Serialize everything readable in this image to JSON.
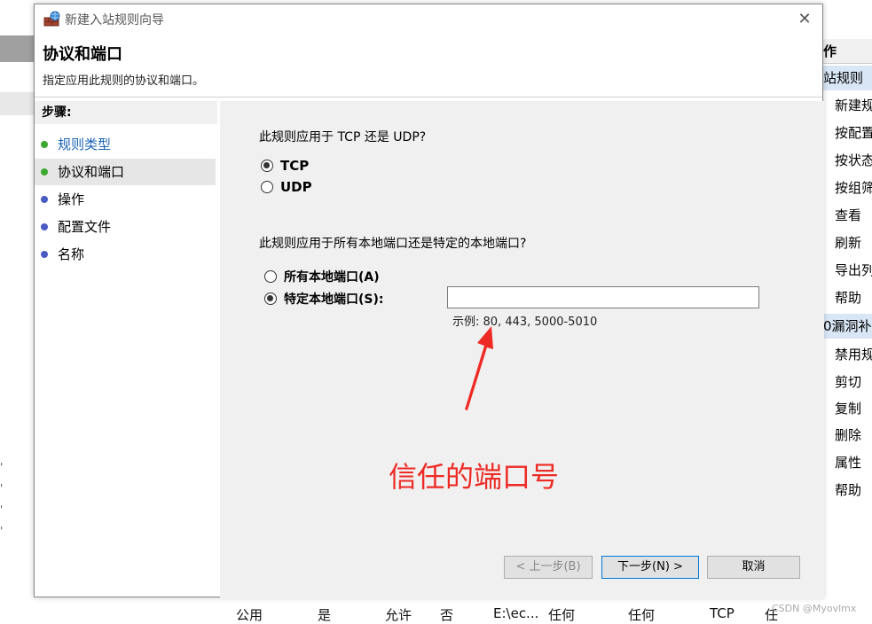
{
  "dialog": {
    "title": "新建入站规则向导",
    "header_title": "协议和端口",
    "header_desc": "指定应用此规则的协议和端口。",
    "steps_heading": "步骤:",
    "steps": [
      {
        "label": "规则类型"
      },
      {
        "label": "协议和端口"
      },
      {
        "label": "操作"
      },
      {
        "label": "配置文件"
      },
      {
        "label": "名称"
      }
    ],
    "question_protocol": "此规则应用于 TCP 还是 UDP?",
    "protocol_options": [
      "TCP",
      "UDP"
    ],
    "question_ports": "此规则应用于所有本地端口还是特定的本地端口?",
    "port_options": [
      "所有本地端口(A)",
      "特定本地端口(S):"
    ],
    "port_value": "",
    "port_example": "示例: 80, 443, 5000-5010",
    "buttons": {
      "back": "< 上一步(B)",
      "next": "下一步(N) >",
      "cancel": "取消"
    }
  },
  "annotation": {
    "text": "信任的端口号",
    "color": "#ee2a24"
  },
  "background": {
    "action_title": "作",
    "action_section1": "站规则",
    "action_items1": [
      "新建规",
      "按配置",
      "按状态",
      "按组筛",
      "查看",
      "刷新",
      "导出列",
      "帮助"
    ],
    "action_section2": "0漏洞补",
    "action_items2": [
      "禁用规",
      "剪切",
      "复制",
      "删除",
      "属性",
      "帮助"
    ],
    "table_row": [
      "公用",
      "是",
      "允许",
      "否",
      "E:\\ec...",
      "任何",
      "任何",
      "TCP",
      "任"
    ]
  },
  "watermark": "CSDN @Myovlmx"
}
